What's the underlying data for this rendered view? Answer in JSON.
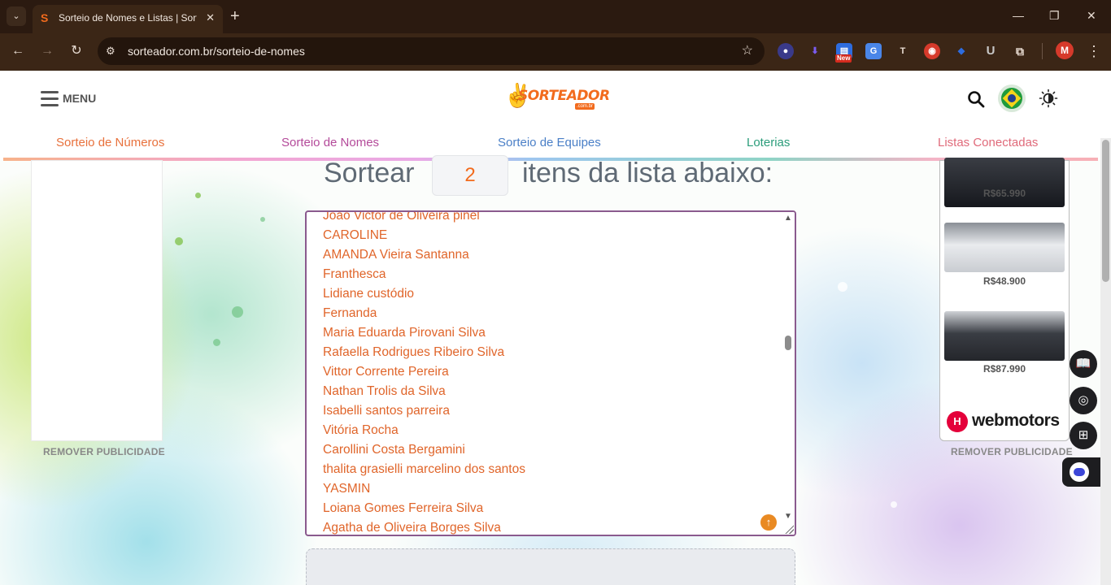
{
  "browser": {
    "tab_title": "Sorteio de Nomes e Listas | Sorteador",
    "url": "sorteador.com.br/sorteio-de-nomes",
    "new_badge": "New",
    "profile_initial": "M",
    "ext_u": "U"
  },
  "header": {
    "menu_label": "MENU",
    "logo_text": "SORTEADOR",
    "logo_sub": ".com.br"
  },
  "nav": {
    "items": [
      {
        "label": "Sorteio de Números",
        "color": "#e8713c"
      },
      {
        "label": "Sorteio de Nomes",
        "color": "#b44a9a"
      },
      {
        "label": "Sorteio de Equipes",
        "color": "#4a7fc7"
      },
      {
        "label": "Loterias",
        "color": "#2a9c7a"
      },
      {
        "label": "Listas Conectadas",
        "color": "#e06a7a"
      }
    ]
  },
  "draw": {
    "prefix": "Sortear",
    "quantity": "2",
    "suffix": "itens da lista abaixo:"
  },
  "names": [
    "João Victor de Oliveira pinel",
    "CAROLINE",
    "AMANDA Vieira Santanna",
    "Franthesca",
    "Lidiane custódio",
    "Fernanda",
    "Maria Eduarda Pirovani Silva",
    "Rafaella Rodrigues Ribeiro Silva",
    "Vittor Corrente Pereira",
    "Nathan Trolis da Silva",
    "Isabelli santos parreira",
    "Vitória Rocha",
    "Carollini Costa Bergamini",
    "thalita grasielli marcelino dos santos",
    "YASMIN",
    "Loiana Gomes Ferreira Silva",
    "Agatha de Oliveira Borges Silva"
  ],
  "ads": {
    "remove_label": "REMOVER PUBLICIDADE",
    "prices": [
      "R$65.990",
      "R$48.900",
      "R$87.990"
    ],
    "brand": "webmotors"
  }
}
